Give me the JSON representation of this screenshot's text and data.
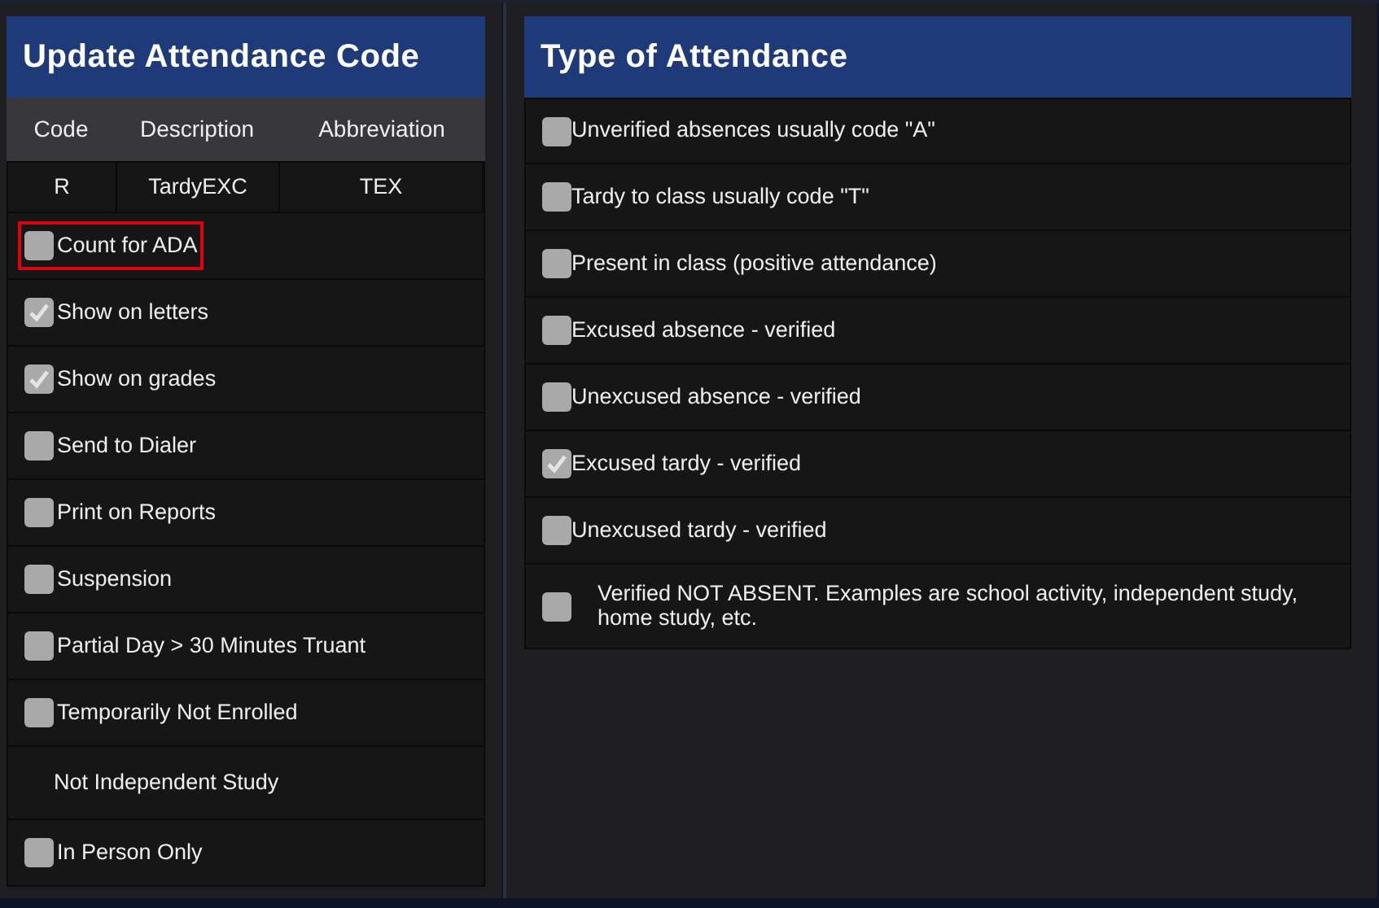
{
  "left_panel": {
    "title": "Update Attendance Code",
    "columns": [
      "Code",
      "Description",
      "Abbreviation"
    ],
    "row": [
      "R",
      "TardyEXC",
      "TEX"
    ],
    "options": [
      {
        "kind": "checkbox",
        "label": "Count for ADA",
        "checked": false,
        "highlighted": true
      },
      {
        "kind": "checkbox",
        "label": "Show on letters",
        "checked": true,
        "highlighted": false
      },
      {
        "kind": "checkbox",
        "label": "Show on grades",
        "checked": true,
        "highlighted": false
      },
      {
        "kind": "checkbox",
        "label": "Send to Dialer",
        "checked": false,
        "highlighted": false
      },
      {
        "kind": "checkbox",
        "label": "Print on Reports",
        "checked": false,
        "highlighted": false
      },
      {
        "kind": "checkbox",
        "label": "Suspension",
        "checked": false,
        "highlighted": false
      },
      {
        "kind": "checkbox",
        "label": "Partial Day > 30 Minutes Truant",
        "checked": false,
        "highlighted": false
      },
      {
        "kind": "checkbox",
        "label": "Temporarily Not Enrolled",
        "checked": false,
        "highlighted": false
      },
      {
        "kind": "text",
        "label": "Not Independent Study"
      },
      {
        "kind": "checkbox",
        "label": "In Person Only",
        "checked": false,
        "highlighted": false
      }
    ]
  },
  "right_panel": {
    "title": "Type of Attendance",
    "options": [
      {
        "label": "Unverified absences usually code \"A\"",
        "checked": false,
        "wide": false
      },
      {
        "label": "Tardy to class usually code \"T\"",
        "checked": false,
        "wide": false
      },
      {
        "label": "Present in class (positive attendance)",
        "checked": false,
        "wide": false
      },
      {
        "label": "Excused absence - verified",
        "checked": false,
        "wide": false
      },
      {
        "label": "Unexcused absence - verified",
        "checked": false,
        "wide": false
      },
      {
        "label": "Excused tardy - verified",
        "checked": true,
        "wide": false
      },
      {
        "label": "Unexcused tardy - verified",
        "checked": false,
        "wide": false
      },
      {
        "label": "Verified NOT ABSENT. Examples are school activity, independent study, home study, etc.",
        "checked": false,
        "wide": true
      }
    ]
  }
}
